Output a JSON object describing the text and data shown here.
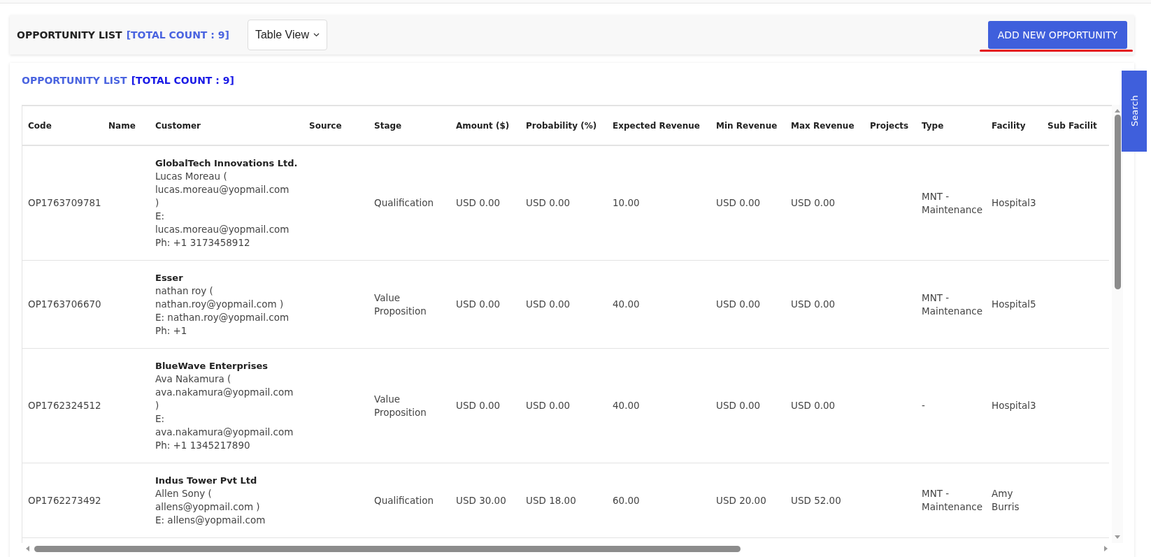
{
  "header": {
    "title": "OPPORTUNITY LIST",
    "count": "[TOTAL COUNT : 9]",
    "view_select": {
      "value": "Table View"
    },
    "add_button": "ADD NEW OPPORTUNITY"
  },
  "list": {
    "title": "OPPORTUNITY LIST",
    "count": "[TOTAL COUNT : 9]",
    "table": {
      "columns": [
        "Code",
        "Name",
        "Customer",
        "Source",
        "Stage",
        "Amount ($)",
        "Probability (%)",
        "Expected Revenue",
        "Min Revenue",
        "Max Revenue",
        "Projects",
        "Type",
        "Facility",
        "Sub Facilit"
      ],
      "rows": [
        {
          "code": "OP1763709781",
          "customer": {
            "company": "GlobalTech Innovations Ltd.",
            "contact": "Lucas Moreau ( lucas.moreau@yopmail.com )",
            "email": "E: lucas.moreau@yopmail.com",
            "phone": "Ph: +1 3173458912"
          },
          "stage": "Qualification",
          "amount": "USD 0.00",
          "probability": "USD 0.00",
          "expected_revenue": "10.00",
          "min_revenue": "USD 0.00",
          "max_revenue": "USD 0.00",
          "type": "MNT - Maintenance",
          "facility": "Hospital3"
        },
        {
          "code": "OP1763706670",
          "customer": {
            "company": "Esser",
            "contact": "nathan roy ( nathan.roy@yopmail.com )",
            "email": "E: nathan.roy@yopmail.com",
            "phone": "Ph: +1"
          },
          "stage": "Value Proposition",
          "amount": "USD 0.00",
          "probability": "USD 0.00",
          "expected_revenue": "40.00",
          "min_revenue": "USD 0.00",
          "max_revenue": "USD 0.00",
          "type": "MNT - Maintenance",
          "facility": "Hospital5"
        },
        {
          "code": "OP1762324512",
          "customer": {
            "company": "BlueWave Enterprises",
            "contact": "Ava Nakamura ( ava.nakamura@yopmail.com )",
            "email": "E: ava.nakamura@yopmail.com",
            "phone": "Ph: +1 1345217890"
          },
          "stage": "Value Proposition",
          "amount": "USD 0.00",
          "probability": "USD 0.00",
          "expected_revenue": "40.00",
          "min_revenue": "USD 0.00",
          "max_revenue": "USD 0.00",
          "type": "-",
          "facility": "Hospital3"
        },
        {
          "code": "OP1762273492",
          "customer": {
            "company": "Indus Tower Pvt Ltd",
            "contact": "Allen Sony ( allens@yopmail.com )",
            "email": "E: allens@yopmail.com"
          },
          "stage": "Qualification",
          "amount": "USD 30.00",
          "probability": "USD 18.00",
          "expected_revenue": "60.00",
          "min_revenue": "USD 20.00",
          "max_revenue": "USD 52.00",
          "type": "MNT - Maintenance",
          "facility": "Amy Burris"
        }
      ]
    }
  },
  "search_tab": "Search"
}
